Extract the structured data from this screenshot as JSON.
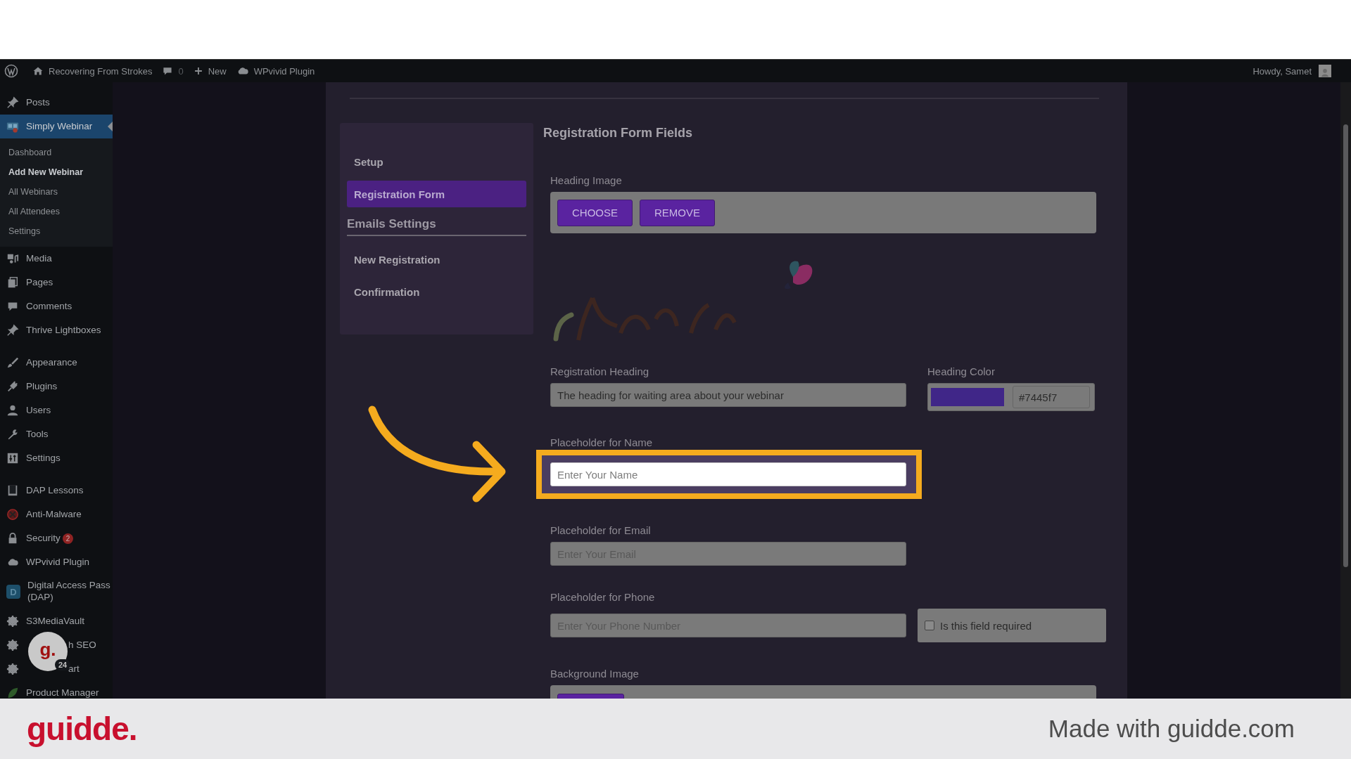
{
  "admin_bar": {
    "site": "Recovering From Strokes",
    "comments": "0",
    "new": "New",
    "plugin": "WPvivid Plugin",
    "greeting": "Howdy, Samet"
  },
  "sidebar": {
    "groups": [
      [
        {
          "label": "Posts",
          "selected": false
        },
        {
          "label": "Simply Webinar",
          "selected": true,
          "expanded": true,
          "children": [
            {
              "label": "Dashboard",
              "selected": false
            },
            {
              "label": "Add New Webinar",
              "selected": true
            },
            {
              "label": "All Webinars",
              "selected": false
            },
            {
              "label": "All Attendees",
              "selected": false
            },
            {
              "label": "Settings",
              "selected": false
            }
          ]
        },
        {
          "label": "Media",
          "selected": false
        },
        {
          "label": "Pages",
          "selected": false
        },
        {
          "label": "Comments",
          "selected": false
        },
        {
          "label": "Thrive Lightboxes",
          "selected": false
        }
      ],
      [
        {
          "label": "Appearance",
          "selected": false
        },
        {
          "label": "Plugins",
          "selected": false
        },
        {
          "label": "Users",
          "selected": false
        },
        {
          "label": "Tools",
          "selected": false
        },
        {
          "label": "Settings",
          "selected": false
        }
      ],
      [
        {
          "label": "DAP Lessons",
          "selected": false
        },
        {
          "label": "Anti-Malware",
          "selected": false
        },
        {
          "label": "Security",
          "selected": false,
          "badge": "2"
        },
        {
          "label": "WPvivid Plugin",
          "selected": false
        },
        {
          "label": "Digital Access Pass (DAP)",
          "selected": false,
          "icon_text": "D"
        },
        {
          "label": "S3MediaVault",
          "selected": false
        },
        {
          "label": "h SEO",
          "selected": false,
          "hidden_start": true
        },
        {
          "label": "art",
          "selected": false,
          "hidden_start": true
        },
        {
          "label": "Product Manager",
          "selected": false
        }
      ]
    ]
  },
  "bubble": {
    "logo": "g.",
    "count": "24"
  },
  "form_nav": [
    {
      "kind": "link",
      "label": "Setup",
      "selected": false
    },
    {
      "kind": "link",
      "label": "Registration Form",
      "selected": true
    },
    {
      "kind": "heading",
      "label": "Emails Settings"
    },
    {
      "kind": "link",
      "label": "New Registration",
      "selected": false
    },
    {
      "kind": "link",
      "label": "Confirmation",
      "selected": false
    }
  ],
  "form": {
    "title": "Registration Form Fields",
    "fields": [
      {
        "label": "Heading Image",
        "buttons": [
          "CHOOSE",
          "REMOVE"
        ],
        "preview": {
          "kind": "picture"
        }
      },
      {
        "kind": "text_color",
        "label": "Registration Heading",
        "value": "The heading for waiting area about your webinar",
        "color_label": "Heading Color",
        "color_value": "#7445f7"
      },
      {
        "kind": "text",
        "label": "Placeholder for Name",
        "placeholder": "Enter Your Name",
        "highlighted": true
      },
      {
        "kind": "text",
        "label": "Placeholder for Email",
        "placeholder": "Enter Your Email",
        "highlighted": false
      },
      {
        "kind": "text_check",
        "label": "Placeholder for Phone",
        "placeholder": "Enter Your Phone Number",
        "check": {
          "label": "Is this field required",
          "checked": false
        }
      },
      {
        "kind": "image_cut",
        "label": "Background Image"
      }
    ]
  },
  "footer": {
    "logo": "guidde.",
    "credit": "Made with guidde.com"
  }
}
